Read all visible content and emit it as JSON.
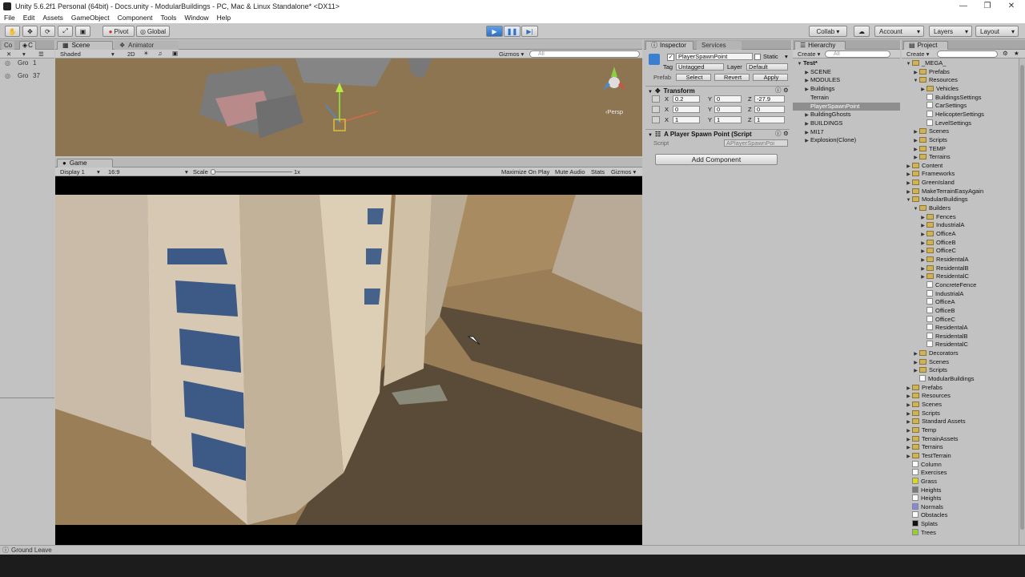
{
  "window": {
    "title": "Unity 5.6.2f1 Personal (64bit) - Docs.unity - ModularBuildings - PC, Mac & Linux Standalone* <DX11>"
  },
  "menu": [
    "File",
    "Edit",
    "Assets",
    "GameObject",
    "Component",
    "Tools",
    "Window",
    "Help"
  ],
  "toolbar": {
    "pivot": "Pivot",
    "global": "Global",
    "collab": "Collab ▾",
    "account": "Account",
    "layers": "Layers",
    "layout": "Layout"
  },
  "left_panel": {
    "tab1": "Co",
    "tab2": "C",
    "rows": [
      {
        "name": "Gro",
        "value": "1"
      },
      {
        "name": "Gro",
        "value": "37"
      }
    ]
  },
  "scene": {
    "tab": "Scene",
    "tab2": "Animator",
    "shaded": "Shaded",
    "mode2d": "2D",
    "gizmos": "Gizmos ▾",
    "search": "All",
    "persp": "‹Persp"
  },
  "game": {
    "tab": "Game",
    "display": "Display 1",
    "aspect": "16:9",
    "scale_label": "Scale",
    "scale_value": "1x",
    "maximize": "Maximize On Play",
    "mute": "Mute Audio",
    "stats": "Stats",
    "gizmos": "Gizmos ▾"
  },
  "inspector": {
    "tab": "Inspector",
    "tab2": "Services",
    "object_name": "PlayerSpawnPoint",
    "static": "Static",
    "tag_label": "Tag",
    "tag_value": "Untagged",
    "layer_label": "Layer",
    "layer_value": "Default",
    "prefab_label": "Prefab",
    "select": "Select",
    "revert": "Revert",
    "apply": "Apply",
    "transform": "Transform",
    "rows": [
      {
        "x": "0.2",
        "y": "0",
        "z": "-27.9"
      },
      {
        "x": "0",
        "y": "0",
        "z": "0"
      },
      {
        "x": "1",
        "y": "1",
        "z": "1"
      }
    ],
    "script_component": "A Player Spawn Point (Script",
    "script_label": "Script",
    "script_value": "APlayerSpawnPoi",
    "add_component": "Add Component"
  },
  "hierarchy": {
    "tab": "Hierarchy",
    "create": "Create ▾",
    "search": "All",
    "items": [
      {
        "label": "Test*",
        "depth": 0,
        "arrow": "▼",
        "bold": true
      },
      {
        "label": "SCENE",
        "depth": 1,
        "arrow": "▶"
      },
      {
        "label": "MODULES",
        "depth": 1,
        "arrow": "▶"
      },
      {
        "label": "Buildings",
        "depth": 1,
        "arrow": "▶"
      },
      {
        "label": "Terrain",
        "depth": 1,
        "arrow": ""
      },
      {
        "label": "PlayerSpawnPoint",
        "depth": 1,
        "arrow": "",
        "selected": true
      },
      {
        "label": "BuildingGhosts",
        "depth": 1,
        "arrow": "▶"
      },
      {
        "label": "BUILDINGS",
        "depth": 1,
        "arrow": "▶"
      },
      {
        "label": "MI17",
        "depth": 1,
        "arrow": "▶"
      },
      {
        "label": "Explosion(Clone)",
        "depth": 1,
        "arrow": "▶"
      }
    ]
  },
  "project": {
    "tab": "Project",
    "create": "Create ▾",
    "items": [
      {
        "label": "_MEGA_",
        "depth": 0,
        "arrow": "▼",
        "icon": "folder"
      },
      {
        "label": "Prefabs",
        "depth": 1,
        "arrow": "▶",
        "icon": "folder"
      },
      {
        "label": "Resources",
        "depth": 1,
        "arrow": "▼",
        "icon": "folder"
      },
      {
        "label": "Vehicles",
        "depth": 2,
        "arrow": "▶",
        "icon": "folder"
      },
      {
        "label": "BuildingsSettings",
        "depth": 2,
        "arrow": "",
        "icon": "file"
      },
      {
        "label": "CarSettings",
        "depth": 2,
        "arrow": "",
        "icon": "file"
      },
      {
        "label": "HelicopterSettings",
        "depth": 2,
        "arrow": "",
        "icon": "file"
      },
      {
        "label": "LevelSettings",
        "depth": 2,
        "arrow": "",
        "icon": "file"
      },
      {
        "label": "Scenes",
        "depth": 1,
        "arrow": "▶",
        "icon": "folder"
      },
      {
        "label": "Scripts",
        "depth": 1,
        "arrow": "▶",
        "icon": "folder"
      },
      {
        "label": "TEMP",
        "depth": 1,
        "arrow": "▶",
        "icon": "folder"
      },
      {
        "label": "Terrains",
        "depth": 1,
        "arrow": "▶",
        "icon": "folder"
      },
      {
        "label": "Content",
        "depth": 0,
        "arrow": "▶",
        "icon": "folder"
      },
      {
        "label": "Frameworks",
        "depth": 0,
        "arrow": "▶",
        "icon": "folder"
      },
      {
        "label": "GreenIsland",
        "depth": 0,
        "arrow": "▶",
        "icon": "folder"
      },
      {
        "label": "MakeTerrainEasyAgain",
        "depth": 0,
        "arrow": "▶",
        "icon": "folder"
      },
      {
        "label": "ModularBuildings",
        "depth": 0,
        "arrow": "▼",
        "icon": "folder"
      },
      {
        "label": "Builders",
        "depth": 1,
        "arrow": "▼",
        "icon": "folder"
      },
      {
        "label": "Fences",
        "depth": 2,
        "arrow": "▶",
        "icon": "folder"
      },
      {
        "label": "IndustrialA",
        "depth": 2,
        "arrow": "▶",
        "icon": "folder"
      },
      {
        "label": "OfficeA",
        "depth": 2,
        "arrow": "▶",
        "icon": "folder"
      },
      {
        "label": "OfficeB",
        "depth": 2,
        "arrow": "▶",
        "icon": "folder"
      },
      {
        "label": "OfficeC",
        "depth": 2,
        "arrow": "▶",
        "icon": "folder"
      },
      {
        "label": "ResidentalA",
        "depth": 2,
        "arrow": "▶",
        "icon": "folder"
      },
      {
        "label": "ResidentalB",
        "depth": 2,
        "arrow": "▶",
        "icon": "folder"
      },
      {
        "label": "ResidentalC",
        "depth": 2,
        "arrow": "▶",
        "icon": "folder"
      },
      {
        "label": "ConcreteFence",
        "depth": 2,
        "arrow": "",
        "icon": "file"
      },
      {
        "label": "IndustrialA",
        "depth": 2,
        "arrow": "",
        "icon": "file"
      },
      {
        "label": "OfficeA",
        "depth": 2,
        "arrow": "",
        "icon": "file"
      },
      {
        "label": "OfficeB",
        "depth": 2,
        "arrow": "",
        "icon": "file"
      },
      {
        "label": "OfficeC",
        "depth": 2,
        "arrow": "",
        "icon": "file"
      },
      {
        "label": "ResidentalA",
        "depth": 2,
        "arrow": "",
        "icon": "file"
      },
      {
        "label": "ResidentalB",
        "depth": 2,
        "arrow": "",
        "icon": "file"
      },
      {
        "label": "ResidentalC",
        "depth": 2,
        "arrow": "",
        "icon": "file"
      },
      {
        "label": "Decorators",
        "depth": 1,
        "arrow": "▶",
        "icon": "folder"
      },
      {
        "label": "Scenes",
        "depth": 1,
        "arrow": "▶",
        "icon": "folder"
      },
      {
        "label": "Scripts",
        "depth": 1,
        "arrow": "▶",
        "icon": "folder"
      },
      {
        "label": "ModularBuildings",
        "depth": 1,
        "arrow": "",
        "icon": "file"
      },
      {
        "label": "Prefabs",
        "depth": 0,
        "arrow": "▶",
        "icon": "folder"
      },
      {
        "label": "Resources",
        "depth": 0,
        "arrow": "▶",
        "icon": "folder"
      },
      {
        "label": "Scenes",
        "depth": 0,
        "arrow": "▶",
        "icon": "folder"
      },
      {
        "label": "Scripts",
        "depth": 0,
        "arrow": "▶",
        "icon": "folder"
      },
      {
        "label": "Standard Assets",
        "depth": 0,
        "arrow": "▶",
        "icon": "folder"
      },
      {
        "label": "Temp",
        "depth": 0,
        "arrow": "▶",
        "icon": "folder"
      },
      {
        "label": "TerrainAssets",
        "depth": 0,
        "arrow": "▶",
        "icon": "folder"
      },
      {
        "label": "Terrains",
        "depth": 0,
        "arrow": "▶",
        "icon": "folder"
      },
      {
        "label": "TestTerrain",
        "depth": 0,
        "arrow": "▶",
        "icon": "folder"
      },
      {
        "label": "Column",
        "depth": 0,
        "arrow": "",
        "icon": "file"
      },
      {
        "label": "Exercises",
        "depth": 0,
        "arrow": "",
        "icon": "file"
      },
      {
        "label": "Grass",
        "depth": 0,
        "arrow": "",
        "icon": "swatch",
        "color": "#d8d820"
      },
      {
        "label": "Heights",
        "depth": 0,
        "arrow": "",
        "icon": "swatch",
        "color": "#7a7a7a"
      },
      {
        "label": "Heights",
        "depth": 0,
        "arrow": "",
        "icon": "file"
      },
      {
        "label": "Normals",
        "depth": 0,
        "arrow": "",
        "icon": "swatch",
        "color": "#8a86e0"
      },
      {
        "label": "Obstacles",
        "depth": 0,
        "arrow": "",
        "icon": "file"
      },
      {
        "label": "Splats",
        "depth": 0,
        "arrow": "",
        "icon": "swatch",
        "color": "#101010"
      },
      {
        "label": "Trees",
        "depth": 0,
        "arrow": "",
        "icon": "swatch",
        "color": "#9acd32"
      }
    ]
  },
  "status": {
    "text": "Ground Leave"
  },
  "colors": {
    "play_accent": "#2e6fc0",
    "selection": "#8e8e8e",
    "sky": "#c7dcec",
    "ground": "#9a7e58"
  }
}
